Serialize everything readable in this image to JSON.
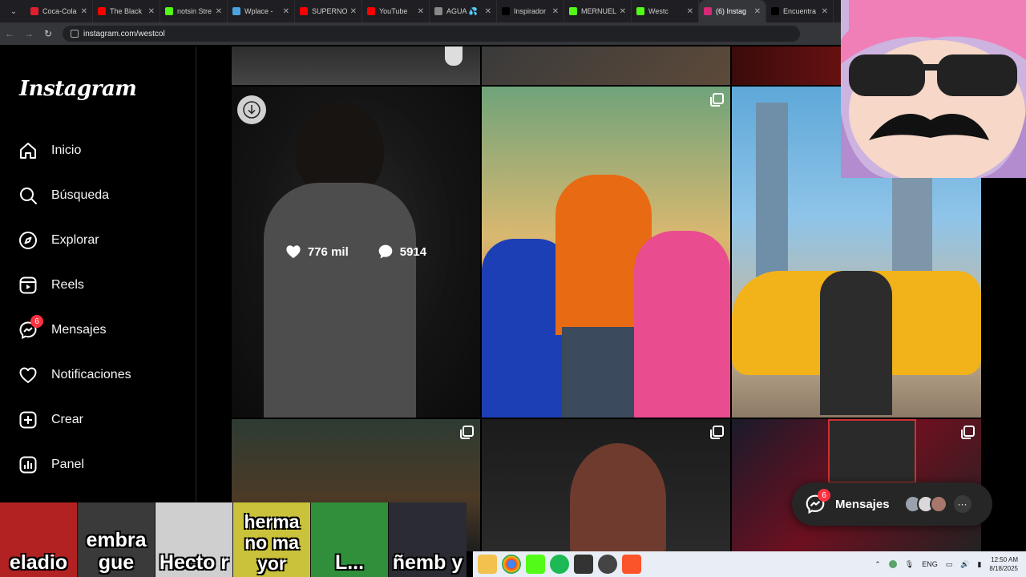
{
  "browser": {
    "tabs": [
      {
        "label": "Coca-Cola",
        "color": "#e01e2d"
      },
      {
        "label": "The Black",
        "color": "#ff0000"
      },
      {
        "label": "notsin Stre",
        "color": "#53fc18"
      },
      {
        "label": "Wplace -",
        "color": "#4aa3df"
      },
      {
        "label": "SUPERNO",
        "color": "#ff0000"
      },
      {
        "label": "YouTube",
        "color": "#ff0000"
      },
      {
        "label": "AGUA 💦",
        "color": "#888888"
      },
      {
        "label": "Inspirador",
        "color": "#000000"
      },
      {
        "label": "MERNUEL",
        "color": "#53fc18"
      },
      {
        "label": "Westc",
        "color": "#53fc18"
      },
      {
        "label": "(6) Instag",
        "color": "#d62976",
        "active": true
      },
      {
        "label": "Encuentra",
        "color": "#000000"
      }
    ],
    "url": "instagram.com/westcol"
  },
  "sidebar": {
    "logo": "Instagram",
    "items": [
      {
        "label": "Inicio",
        "icon": "home-icon"
      },
      {
        "label": "Búsqueda",
        "icon": "search-icon"
      },
      {
        "label": "Explorar",
        "icon": "compass-icon"
      },
      {
        "label": "Reels",
        "icon": "reels-icon"
      },
      {
        "label": "Mensajes",
        "icon": "messenger-icon",
        "badge": "6"
      },
      {
        "label": "Notificaciones",
        "icon": "heart-icon"
      },
      {
        "label": "Crear",
        "icon": "plus-square-icon"
      },
      {
        "label": "Panel",
        "icon": "chart-icon"
      }
    ]
  },
  "post_hover": {
    "likes": "776 mil",
    "comments": "5914"
  },
  "messages_pill": {
    "label": "Mensajes",
    "badge": "6"
  },
  "chat_thumbs": [
    {
      "text": "eladio",
      "bg": "#b22222"
    },
    {
      "text": "embra gue",
      "bg": "#3a3a3a"
    },
    {
      "text": "Hecto r",
      "bg": "#cfcfcf"
    },
    {
      "text": "herma no ma yor",
      "bg": "#c9c23a"
    },
    {
      "text": "L...",
      "bg": "#2f8f3a"
    },
    {
      "text": "ñemb y",
      "bg": "#2b2b33"
    }
  ],
  "taskbar": {
    "lang": "ENG",
    "time": "12:50 AM",
    "date": "8/18/2025"
  }
}
